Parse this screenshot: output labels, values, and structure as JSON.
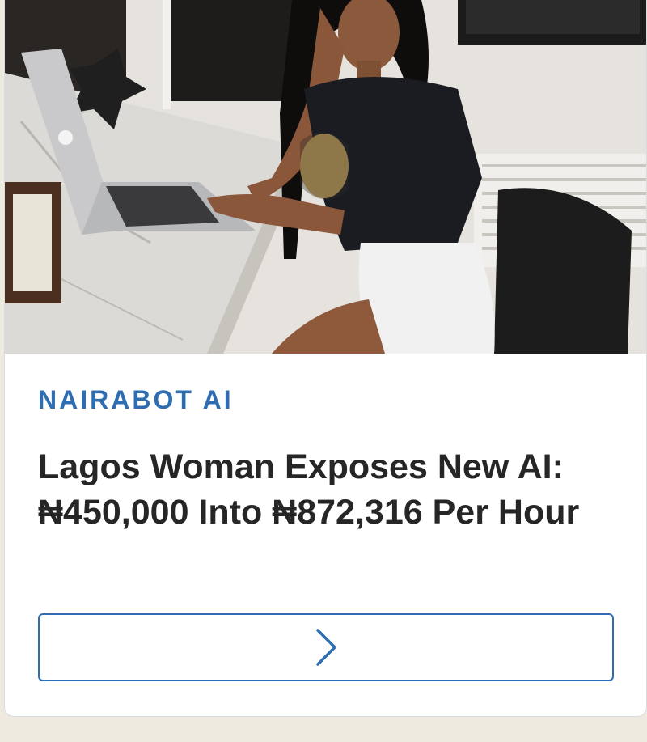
{
  "ad": {
    "brand": "NAIRABOT AI",
    "headline": "Lagos Woman Exposes New AI: ₦450,000 Into ₦872,316 Per Hour",
    "cta_icon": "chevron-right-icon"
  },
  "colors": {
    "accent": "#2f6db3",
    "headline": "#262626",
    "page_background": "#efeadf",
    "card_background": "#ffffff"
  }
}
